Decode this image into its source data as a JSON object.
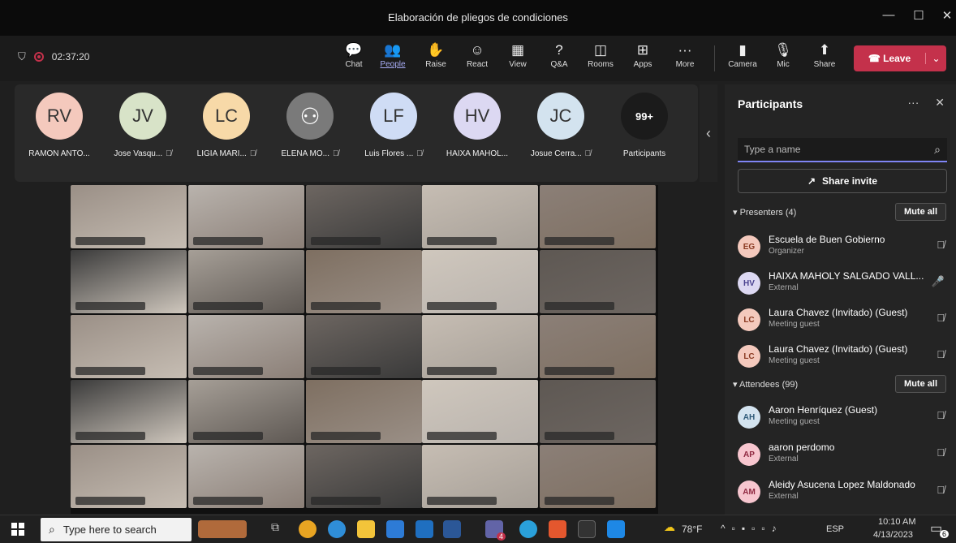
{
  "window": {
    "title": "Elaboración de pliegos de condiciones",
    "minimize": "—",
    "maximize": "☐",
    "close": "✕"
  },
  "toolbar": {
    "timer": "02:37:20",
    "buttons": [
      {
        "label": "Chat",
        "icon": "chat-icon",
        "glyph": "💬"
      },
      {
        "label": "People",
        "icon": "people-icon",
        "glyph": "👥"
      },
      {
        "label": "Raise",
        "icon": "raise-hand-icon",
        "glyph": "✋"
      },
      {
        "label": "React",
        "icon": "react-icon",
        "glyph": "☺"
      },
      {
        "label": "View",
        "icon": "grid-view-icon",
        "glyph": "▦"
      },
      {
        "label": "Q&A",
        "icon": "qna-icon",
        "glyph": "?"
      },
      {
        "label": "Rooms",
        "icon": "rooms-icon",
        "glyph": "◫"
      },
      {
        "label": "Apps",
        "icon": "apps-icon",
        "glyph": "⊞"
      },
      {
        "label": "More",
        "icon": "more-icon",
        "glyph": "···"
      }
    ],
    "camera": "Camera",
    "mic": "Mic",
    "share": "Share",
    "leave": "Leave"
  },
  "strip": {
    "tiles": [
      {
        "initials": "RV",
        "name": "RAMON ANTO...",
        "color": "#f4c9bd",
        "muted": false
      },
      {
        "initials": "JV",
        "name": "Jose Vasqu...",
        "color": "#d8e3c8",
        "muted": true
      },
      {
        "initials": "LC",
        "name": "LIGIA MARI...",
        "color": "#f7d9a8",
        "muted": true
      },
      {
        "initials": "",
        "name": "ELENA MO...",
        "color": "#7a7a7a",
        "muted": true
      },
      {
        "initials": "LF",
        "name": "Luis Flores ...",
        "color": "#cfdcf5",
        "muted": true
      },
      {
        "initials": "HV",
        "name": "HAIXA MAHOL...",
        "color": "#dcd8f2",
        "muted": false
      },
      {
        "initials": "JC",
        "name": "Josue Cerra...",
        "color": "#d3e3ef",
        "muted": true
      },
      {
        "initials": "99+",
        "name": "Participants",
        "color": "#1b1b1b",
        "muted": false
      }
    ]
  },
  "panel": {
    "title": "Participants",
    "more": "···",
    "close": "✕",
    "search_placeholder": "Type a name",
    "invite": "Share invite",
    "presenters_label": "Presenters (4)",
    "attendees_label": "Attendees (99)",
    "mute_all": "Mute all",
    "presenters": [
      {
        "initials": "EG",
        "name": "Escuela de Buen Gobierno",
        "role": "Organizer",
        "color": "#f4c9bd",
        "fg": "#8a3a22",
        "mic": "muted"
      },
      {
        "initials": "HV",
        "name": "HAIXA MAHOLY SALGADO VALL...",
        "role": "External",
        "color": "#dcd8f2",
        "fg": "#4a4390",
        "mic": "on"
      },
      {
        "initials": "LC",
        "name": "Laura Chavez (Invitado) (Guest)",
        "role": "Meeting guest",
        "color": "#f4c9bd",
        "fg": "#8a3a22",
        "mic": "muted"
      },
      {
        "initials": "LC",
        "name": "Laura Chavez (Invitado) (Guest)",
        "role": "Meeting guest",
        "color": "#f4c9bd",
        "fg": "#8a3a22",
        "mic": "muted"
      }
    ],
    "attendees": [
      {
        "initials": "AH",
        "name": "Aaron Henríquez (Guest)",
        "role": "Meeting guest",
        "color": "#d3e3ef",
        "fg": "#2f5a78",
        "mic": "muted"
      },
      {
        "initials": "AP",
        "name": "aaron perdomo",
        "role": "External",
        "color": "#f7c6cf",
        "fg": "#8f2840",
        "mic": "muted"
      },
      {
        "initials": "AM",
        "name": "Aleidy Asucena Lopez Maldonado",
        "role": "External",
        "color": "#f7c6cf",
        "fg": "#8f2840",
        "mic": "muted"
      }
    ]
  },
  "taskbar": {
    "search_placeholder": "Type here to search",
    "weather": "78°F",
    "lang": "ESP",
    "time": "10:10 AM",
    "date": "4/13/2023",
    "notif_count": "6",
    "teams_badge": "4"
  }
}
